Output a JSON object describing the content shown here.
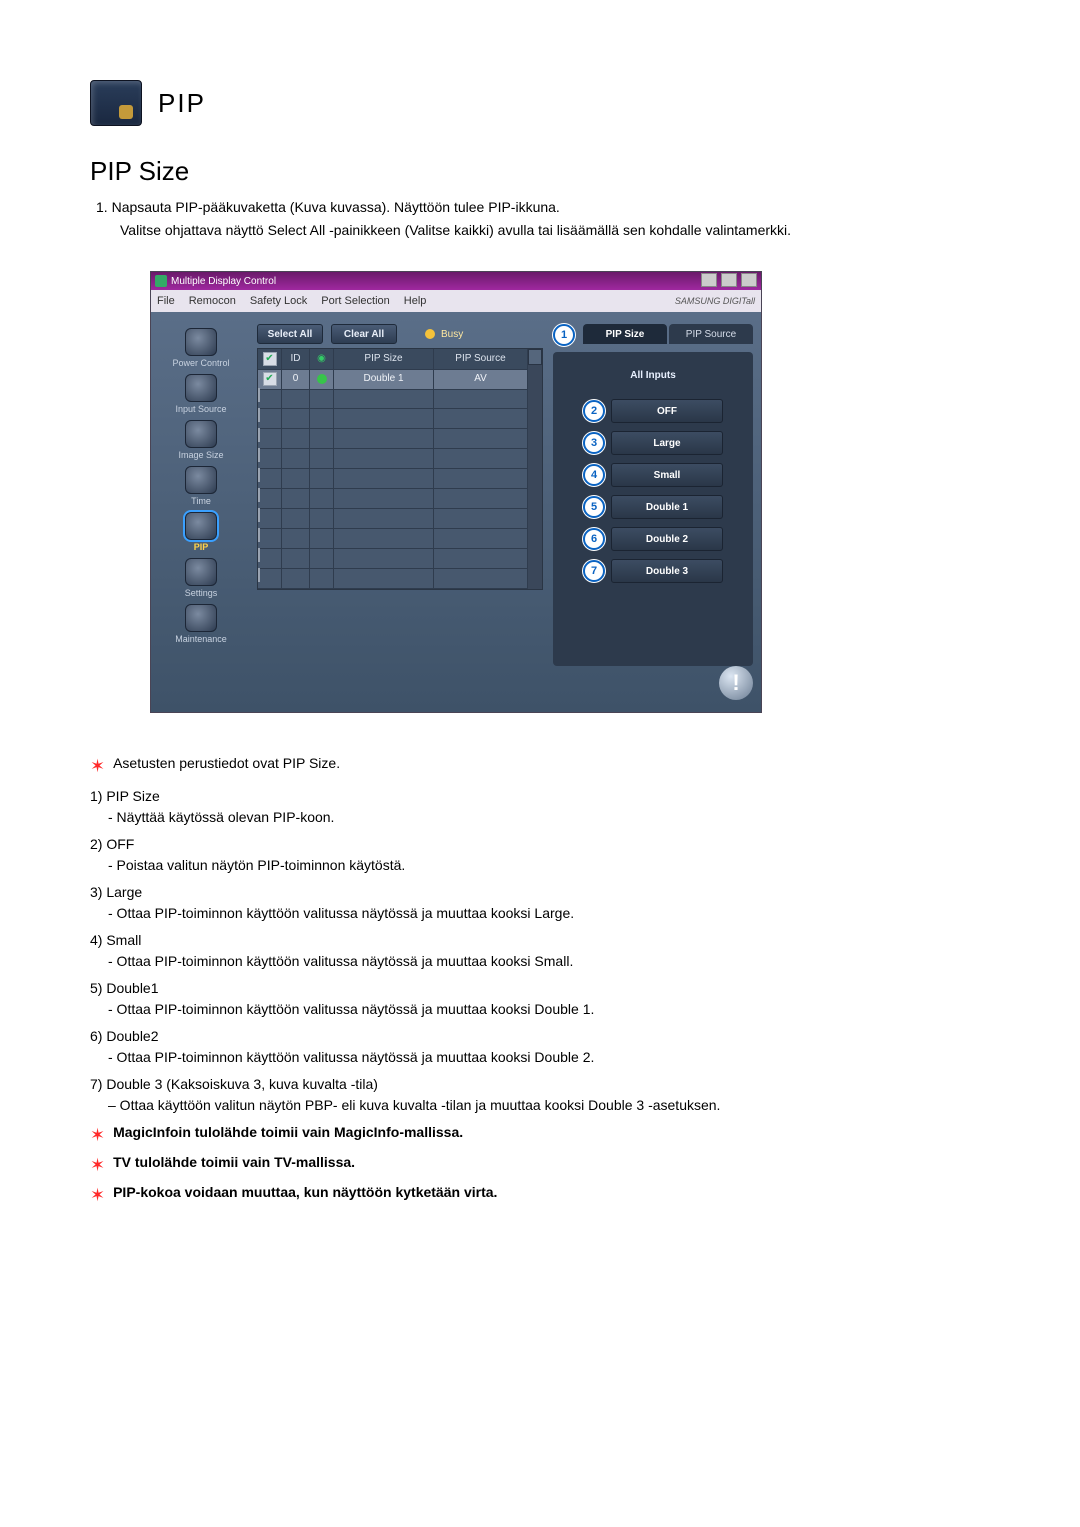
{
  "title": {
    "main": "PIP",
    "section": "PIP Size"
  },
  "intro": {
    "line1_prefix": "1.",
    "line1": "Napsauta PIP-pääkuvaketta (Kuva kuvassa). Näyttöön tulee PIP-ikkuna.",
    "line2": "Valitse ohjattava näyttö Select All -painikkeen (Valitse kaikki) avulla tai lisäämällä sen kohdalle valintamerkki."
  },
  "app": {
    "windowTitle": "Multiple Display Control",
    "menus": [
      "File",
      "Remocon",
      "Safety Lock",
      "Port Selection",
      "Help"
    ],
    "brand": "SAMSUNG DIGITall",
    "buttons": {
      "selectAll": "Select All",
      "clearAll": "Clear All",
      "busy": "Busy"
    },
    "nav": {
      "power": "Power Control",
      "input": "Input Source",
      "image": "Image Size",
      "time": "Time",
      "pip": "PIP",
      "settings": "Settings",
      "maintenance": "Maintenance"
    },
    "gridHeaders": {
      "id": "ID",
      "pipSize": "PIP Size",
      "pipSource": "PIP Source"
    },
    "gridRow": {
      "id": "0",
      "pipSize": "Double 1",
      "pipSource": "AV"
    },
    "tabs": {
      "pipSize": "PIP Size",
      "pipSource": "PIP Source"
    },
    "panelHeader": "All Inputs",
    "options": {
      "off": "OFF",
      "large": "Large",
      "small": "Small",
      "double1": "Double 1",
      "double2": "Double 2",
      "double3": "Double 3"
    },
    "markers": {
      "m1": "1",
      "m2": "2",
      "m3": "3",
      "m4": "4",
      "m5": "5",
      "m6": "6",
      "m7": "7"
    }
  },
  "notes": {
    "intro": "Asetusten perustiedot ovat PIP Size.",
    "items": [
      {
        "num": "1)",
        "title": "PIP Size",
        "desc": "- Näyttää käytössä olevan PIP-koon."
      },
      {
        "num": "2)",
        "title": "OFF",
        "desc": "- Poistaa valitun näytön PIP-toiminnon käytöstä."
      },
      {
        "num": "3)",
        "title": "Large",
        "desc": "- Ottaa PIP-toiminnon käyttöön valitussa näytössä ja muuttaa kooksi Large."
      },
      {
        "num": "4)",
        "title": "Small",
        "desc": "- Ottaa PIP-toiminnon käyttöön valitussa näytössä ja muuttaa kooksi Small."
      },
      {
        "num": "5)",
        "title": "Double1",
        "desc": "- Ottaa PIP-toiminnon käyttöön valitussa näytössä ja muuttaa kooksi Double 1."
      },
      {
        "num": "6)",
        "title": "Double2",
        "desc": "- Ottaa PIP-toiminnon käyttöön valitussa näytössä ja muuttaa kooksi Double 2."
      },
      {
        "num": "7)",
        "title": "Double 3 (Kaksoiskuva 3, kuva kuvalta -tila)",
        "desc": "– Ottaa käyttöön valitun näytön PBP- eli kuva kuvalta -tilan ja muuttaa kooksi Double 3 -asetuksen."
      }
    ],
    "footers": [
      "MagicInfoin tulolähde toimii vain MagicInfo-mallissa.",
      "TV tulolähde toimii vain TV-mallissa.",
      "PIP-kokoa voidaan muuttaa, kun näyttöön kytketään virta."
    ]
  }
}
